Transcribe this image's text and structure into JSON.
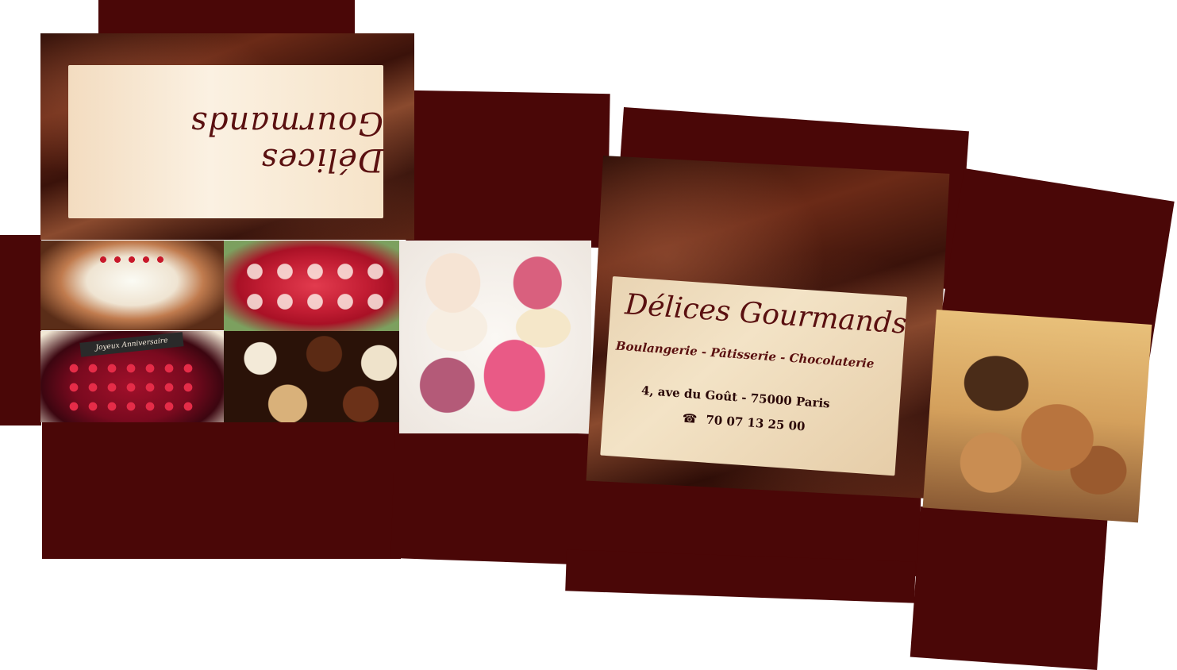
{
  "colors": {
    "panel": "#4a0707",
    "label_text": "#5a1010",
    "label_bg": "#f6e6cf"
  },
  "top_label": {
    "brand_name": "Délices Gourmands"
  },
  "front_card": {
    "brand_name": "Délices Gourmands",
    "tagline": "Boulangerie - Pâtisserie - Chocolaterie",
    "address": "4, ave du Goût - 75000 Paris",
    "phone_icon": "telephone-icon",
    "phone_glyph": "☎",
    "phone": "70 07 13 25 00"
  },
  "cake_photo": {
    "banner_text": "Joyeux Anniversaire"
  }
}
